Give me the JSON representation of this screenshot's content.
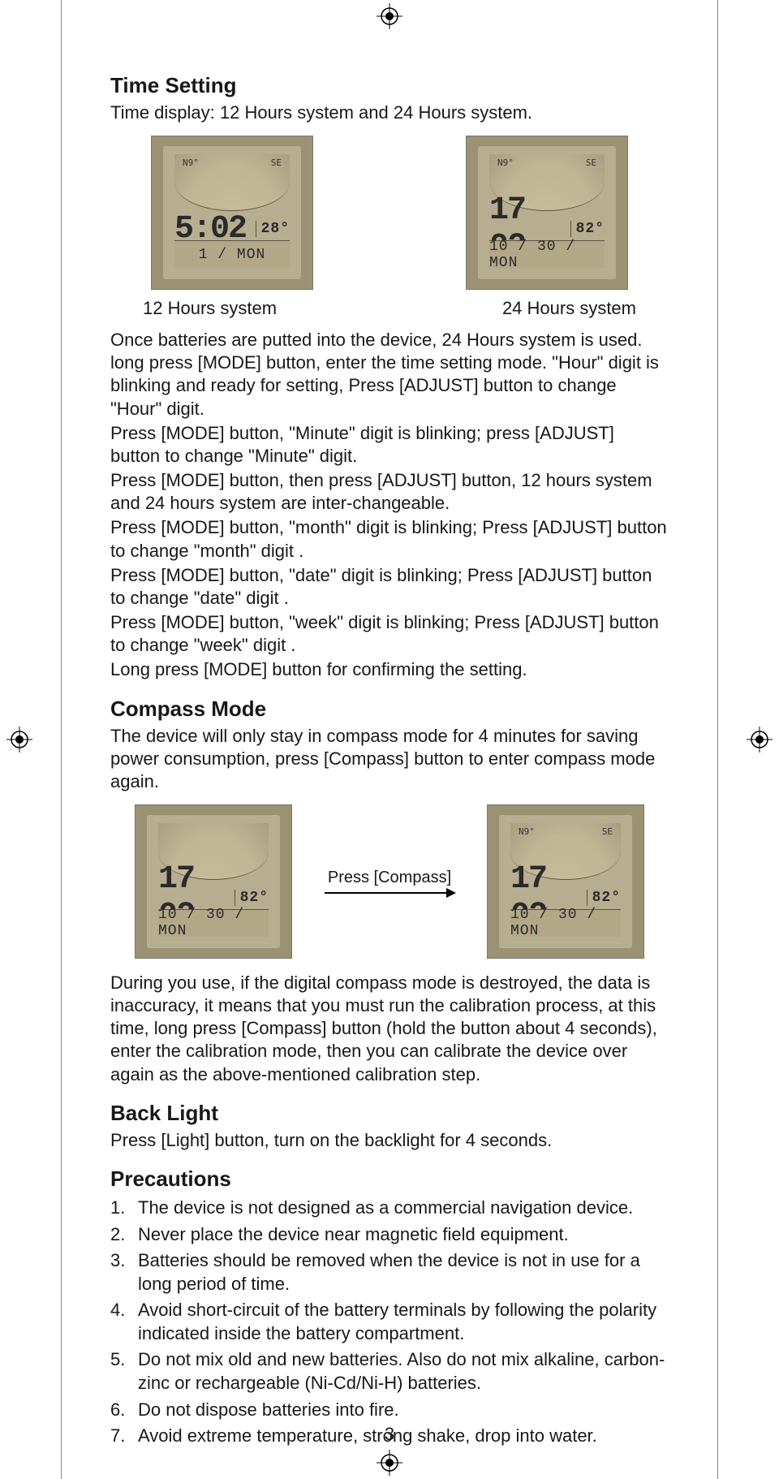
{
  "sections": {
    "time_setting": {
      "title": "Time Setting",
      "intro": "Time display: 12 Hours system and 24 Hours system.",
      "caption12": "12 Hours system",
      "caption24": "24 Hours system",
      "p1": "Once batteries are putted into the device, 24 Hours system is used. long press [MODE] button, enter the time setting mode. \"Hour\" digit is blinking and ready for setting, Press [ADJUST] button to change \"Hour\" digit.",
      "p2": "Press [MODE] button, \"Minute\" digit is blinking; press [ADJUST] button to change \"Minute\" digit.",
      "p3": "Press [MODE] button, then press [ADJUST] button, 12 hours system and 24 hours system are inter-changeable.",
      "p4": "Press [MODE] button, \"month\" digit is blinking; Press [ADJUST] button to change \"month\" digit .",
      "p5": "Press [MODE] button, \"date\" digit is blinking; Press [ADJUST] button to change \"date\" digit .",
      "p6": "Press [MODE] button, \"week\" digit is blinking; Press [ADJUST] button to change \"week\" digit .",
      "p7": "Long press [MODE] button for confirming the setting."
    },
    "compass_mode": {
      "title": "Compass Mode",
      "p1": "The device will only stay in compass mode for 4 minutes for saving power consumption, press [Compass] button to enter compass mode again.",
      "mid_caption": "Press [Compass]",
      "p2": "During you use, if the digital compass mode is destroyed, the data is inaccuracy, it means that you must run the calibration process, at this time, long press [Compass] button (hold the button about 4 seconds), enter the calibration mode, then you can calibrate the device over again as the above-mentioned calibration step."
    },
    "back_light": {
      "title": "Back Light",
      "p1": "Press [Light] button, turn on the backlight for 4 seconds."
    },
    "precautions": {
      "title": "Precautions",
      "items": [
        "The device is not designed as a commercial navigation device.",
        "Never place the device near magnetic field equipment.",
        "Batteries should be removed when the device is not in use for a long period of time.",
        "Avoid short-circuit of the battery terminals by following the polarity indicated inside the battery compartment.",
        "Do not mix old and new batteries. Also do not mix alkaline, carbon-zinc or rechargeable (Ni-Cd/Ni-H) batteries.",
        "Do not dispose batteries into fire.",
        "Avoid extreme temperature, strong shake, drop into water."
      ]
    }
  },
  "lcd": {
    "img1": {
      "time": "5:02",
      "temp": "28°",
      "date": "1 / MON",
      "ne": "N9°",
      "se": "SE"
    },
    "img2": {
      "time": "17 02",
      "temp": "82°",
      "date": "10 / 30 / MON",
      "ne": "N9°",
      "se": "SE"
    },
    "img3": {
      "time": "17 02",
      "temp": "82°",
      "date": "10 / 30 / MON",
      "ne": "",
      "se": ""
    },
    "img4": {
      "time": "17 02",
      "temp": "82°",
      "date": "10 / 30 / MON",
      "ne": "N9°",
      "se": "SE"
    }
  },
  "page_number": "3"
}
